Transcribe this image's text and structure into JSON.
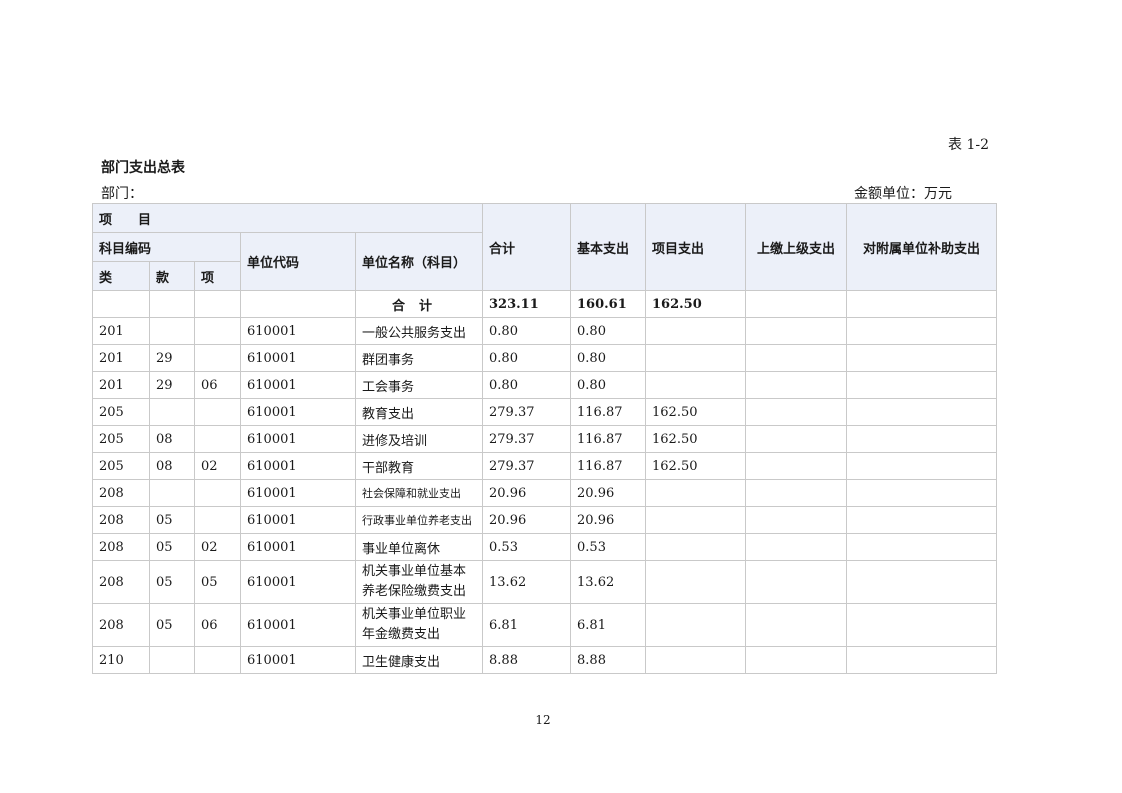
{
  "header": {
    "table_label": "表 1-2",
    "title": "部门支出总表",
    "department_label": "部门：",
    "unit_label": "金额单位：万元"
  },
  "table": {
    "headers": {
      "project": "项　　目",
      "subject_code": "科目编码",
      "class": "类",
      "section": "款",
      "item": "项",
      "unit_code": "单位代码",
      "unit_name": "单位名称（科目）",
      "total": "合计",
      "basic": "基本支出",
      "project_exp": "项目支出",
      "upper": "上缴上级支出",
      "subsidy": "对附属单位补助支出"
    },
    "total_row": {
      "label": "合计",
      "total": "323.11",
      "basic": "160.61",
      "project": "162.50"
    },
    "rows": [
      {
        "class": "201",
        "section": "",
        "item": "",
        "unit_code": "610001",
        "name": "一般公共服务支出",
        "total": "0.80",
        "basic": "0.80",
        "project": "",
        "upper": "",
        "subsidy": ""
      },
      {
        "class": "201",
        "section": "29",
        "item": "",
        "unit_code": "610001",
        "name": "群团事务",
        "total": "0.80",
        "basic": "0.80",
        "project": "",
        "upper": "",
        "subsidy": ""
      },
      {
        "class": "201",
        "section": "29",
        "item": "06",
        "unit_code": "610001",
        "name": "工会事务",
        "total": "0.80",
        "basic": "0.80",
        "project": "",
        "upper": "",
        "subsidy": ""
      },
      {
        "class": "205",
        "section": "",
        "item": "",
        "unit_code": "610001",
        "name": "教育支出",
        "total": "279.37",
        "basic": "116.87",
        "project": "162.50",
        "upper": "",
        "subsidy": ""
      },
      {
        "class": "205",
        "section": "08",
        "item": "",
        "unit_code": "610001",
        "name": "进修及培训",
        "total": "279.37",
        "basic": "116.87",
        "project": "162.50",
        "upper": "",
        "subsidy": ""
      },
      {
        "class": "205",
        "section": "08",
        "item": "02",
        "unit_code": "610001",
        "name": "干部教育",
        "total": "279.37",
        "basic": "116.87",
        "project": "162.50",
        "upper": "",
        "subsidy": ""
      },
      {
        "class": "208",
        "section": "",
        "item": "",
        "unit_code": "610001",
        "name": "社会保障和就业支出",
        "total": "20.96",
        "basic": "20.96",
        "project": "",
        "upper": "",
        "subsidy": ""
      },
      {
        "class": "208",
        "section": "05",
        "item": "",
        "unit_code": "610001",
        "name": "行政事业单位养老支出",
        "total": "20.96",
        "basic": "20.96",
        "project": "",
        "upper": "",
        "subsidy": ""
      },
      {
        "class": "208",
        "section": "05",
        "item": "02",
        "unit_code": "610001",
        "name": "事业单位离休",
        "total": "0.53",
        "basic": "0.53",
        "project": "",
        "upper": "",
        "subsidy": ""
      },
      {
        "class": "208",
        "section": "05",
        "item": "05",
        "unit_code": "610001",
        "name": "机关事业单位基本养老保险缴费支出",
        "total": "13.62",
        "basic": "13.62",
        "project": "",
        "upper": "",
        "subsidy": ""
      },
      {
        "class": "208",
        "section": "05",
        "item": "06",
        "unit_code": "610001",
        "name": "机关事业单位职业年金缴费支出",
        "total": "6.81",
        "basic": "6.81",
        "project": "",
        "upper": "",
        "subsidy": ""
      },
      {
        "class": "210",
        "section": "",
        "item": "",
        "unit_code": "610001",
        "name": "卫生健康支出",
        "total": "8.88",
        "basic": "8.88",
        "project": "",
        "upper": "",
        "subsidy": ""
      }
    ]
  },
  "footer": {
    "page_number": "12"
  }
}
